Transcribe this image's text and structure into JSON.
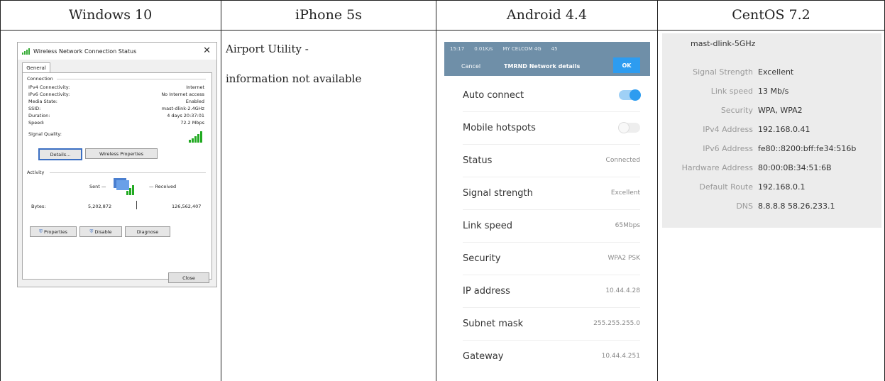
{
  "headers": [
    "Windows 10",
    "iPhone 5s",
    "Android 4.4",
    "CentOS 7.2"
  ],
  "windows": {
    "title": "Wireless Network Connection Status",
    "tab": "General",
    "connection_label": "Connection",
    "rows": [
      {
        "k": "IPv4 Connectivity:",
        "v": "Internet"
      },
      {
        "k": "IPv6 Connectivity:",
        "v": "No Internet access"
      },
      {
        "k": "Media State:",
        "v": "Enabled"
      },
      {
        "k": "SSID:",
        "v": "mast-dlink-2.4GHz"
      },
      {
        "k": "Duration:",
        "v": "4 days 20:37:01"
      },
      {
        "k": "Speed:",
        "v": "72.2 Mbps"
      }
    ],
    "signal_quality": "Signal Quality:",
    "details_btn": "Details...",
    "wireless_props_btn": "Wireless Properties",
    "activity_label": "Activity",
    "sent": "Sent",
    "received": "Received",
    "bytes_label": "Bytes:",
    "bytes_sent": "5,202,872",
    "bytes_received": "126,562,407",
    "properties_btn": "Properties",
    "disable_btn": "Disable",
    "diagnose_btn": "Diagnose",
    "close_btn": "Close"
  },
  "iphone": {
    "line1": "Airport Utility -",
    "line2": "information not available"
  },
  "android": {
    "status_time": "15:17",
    "status_speed": "0.01K/s",
    "status_carrier": "MY CELCOM 4G",
    "status_batt": "45",
    "cancel": "Cancel",
    "title": "TMRND Network details",
    "ok": "OK",
    "items": [
      {
        "label": "Auto connect",
        "toggle": "on"
      },
      {
        "label": "Mobile hotspots",
        "toggle": "off"
      },
      {
        "label": "Status",
        "value": "Connected"
      },
      {
        "label": "Signal strength",
        "value": "Excellent"
      },
      {
        "label": "Link speed",
        "value": "65Mbps"
      },
      {
        "label": "Security",
        "value": "WPA2 PSK"
      },
      {
        "label": "IP address",
        "value": "10.44.4.28"
      },
      {
        "label": "Subnet mask",
        "value": "255.255.255.0"
      },
      {
        "label": "Gateway",
        "value": "10.44.4.251"
      }
    ]
  },
  "centos": {
    "network": "mast-dlink-5GHz",
    "rows": [
      {
        "k": "Signal Strength",
        "v": "Excellent"
      },
      {
        "k": "Link speed",
        "v": "13 Mb/s"
      },
      {
        "k": "Security",
        "v": "WPA, WPA2"
      },
      {
        "k": "IPv4 Address",
        "v": "192.168.0.41"
      },
      {
        "k": "IPv6 Address",
        "v": "fe80::8200:bff:fe34:516b"
      },
      {
        "k": "Hardware Address",
        "v": "80:00:0B:34:51:6B"
      },
      {
        "k": "Default Route",
        "v": "192.168.0.1"
      },
      {
        "k": "DNS",
        "v": "8.8.8.8 58.26.233.1"
      }
    ]
  }
}
